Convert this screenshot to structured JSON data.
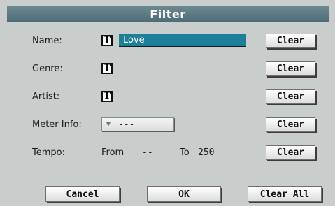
{
  "dialog": {
    "title": "Filter"
  },
  "fields": {
    "name": {
      "label": "Name:",
      "value": "Love",
      "clear": "Clear",
      "icon": "text-edit-icon",
      "icon_glyph": "T"
    },
    "genre": {
      "label": "Genre:",
      "value": "",
      "clear": "Clear",
      "icon": "text-edit-icon",
      "icon_glyph": "T"
    },
    "artist": {
      "label": "Artist:",
      "value": "",
      "clear": "Clear",
      "icon": "text-edit-icon",
      "icon_glyph": "T"
    },
    "meter": {
      "label": "Meter Info:",
      "value": "---",
      "clear": "Clear",
      "arrow": "▼"
    },
    "tempo": {
      "label": "Tempo:",
      "from_label": "From",
      "from_value": "--",
      "to_label": "To",
      "to_value": "250",
      "clear": "Clear"
    }
  },
  "footer": {
    "cancel": "Cancel",
    "ok": "OK",
    "clear_all": "Clear All"
  },
  "colors": {
    "title_bar": "#5b7880",
    "selected_field": "#1f7e98",
    "panel": "#c9cdcb"
  }
}
